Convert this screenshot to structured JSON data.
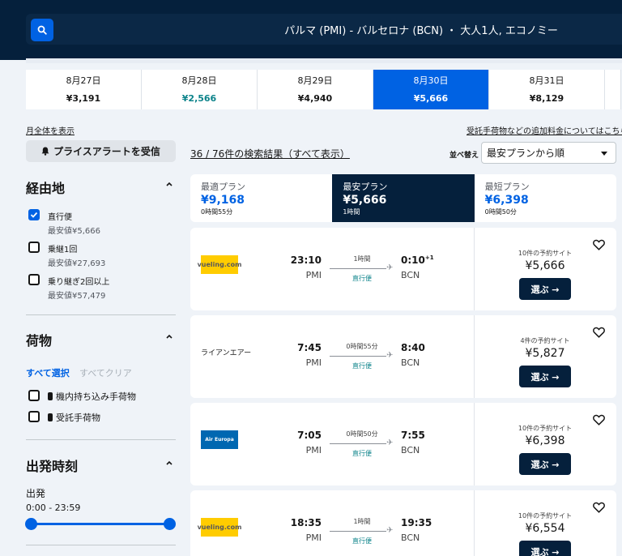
{
  "header": {
    "route": "パルマ (PMI) - バルセロナ (BCN)  ・ 大人1人, エコノミー",
    "search_icon": "search-icon"
  },
  "dates": [
    {
      "date": "8月27日",
      "price": "¥3,191",
      "state": "normal"
    },
    {
      "date": "8月28日",
      "price": "¥2,566",
      "state": "cheapest"
    },
    {
      "date": "8月29日",
      "price": "¥4,940",
      "state": "normal"
    },
    {
      "date": "8月30日",
      "price": "¥5,666",
      "state": "selected"
    },
    {
      "date": "8月31日",
      "price": "¥8,129",
      "state": "normal"
    }
  ],
  "links": {
    "whole_month": "月全体を表示",
    "baggage_fees": "受託手荷物などの追加料金についてはこちら"
  },
  "price_alert": "プライスアラートを受信",
  "filters": {
    "stops": {
      "title": "経由地",
      "options": [
        {
          "label": "直行便",
          "sub": "最安値¥5,666",
          "checked": true
        },
        {
          "label": "乗継1回",
          "sub": "最安値¥27,693",
          "checked": false
        },
        {
          "label": "乗り継ぎ2回以上",
          "sub": "最安値¥57,479",
          "checked": false
        }
      ]
    },
    "bags": {
      "title": "荷物",
      "select_all": "すべて選択",
      "clear_all": "すべてクリア",
      "options": [
        {
          "label": "機内持ち込み手荷物",
          "checked": false
        },
        {
          "label": "受託手荷物",
          "checked": false
        }
      ]
    },
    "departure_time": {
      "title": "出発時刻",
      "label": "出発",
      "range": "0:00 - 23:59",
      "min_fraction": 0,
      "max_fraction": 1
    }
  },
  "results": {
    "count": "36 / 76件の検索結果（すべて表示）",
    "sort_label": "並べ替え",
    "sort_value": "最安プランから順"
  },
  "summary_tabs": [
    {
      "title": "最適プラン",
      "price": "¥9,168",
      "duration": "0時間55分",
      "active": false
    },
    {
      "title": "最安プラン",
      "price": "¥5,666",
      "duration": "1時間",
      "active": true
    },
    {
      "title": "最短プラン",
      "price": "¥6,398",
      "duration": "0時間50分",
      "active": false
    }
  ],
  "flights": [
    {
      "airline": "vueling.com",
      "logo": "vueling",
      "dep_time": "23:10",
      "dep_code": "PMI",
      "arr_time": "0:10",
      "arr_plus": "+1",
      "arr_code": "BCN",
      "duration": "1時間",
      "stops": "直行便",
      "sites": "10件の予約サイト",
      "price": "¥5,666",
      "button": "選ぶ →"
    },
    {
      "airline": "ライアンエアー",
      "logo": "text",
      "dep_time": "7:45",
      "dep_code": "PMI",
      "arr_time": "8:40",
      "arr_plus": "",
      "arr_code": "BCN",
      "duration": "0時間55分",
      "stops": "直行便",
      "sites": "4件の予約サイト",
      "price": "¥5,827",
      "button": "選ぶ →"
    },
    {
      "airline": "Air Europa",
      "logo": "aireuropa",
      "dep_time": "7:05",
      "dep_code": "PMI",
      "arr_time": "7:55",
      "arr_plus": "",
      "arr_code": "BCN",
      "duration": "0時間50分",
      "stops": "直行便",
      "sites": "10件の予約サイト",
      "price": "¥6,398",
      "button": "選ぶ →"
    },
    {
      "airline": "vueling.com",
      "logo": "vueling",
      "dep_time": "18:35",
      "dep_code": "PMI",
      "arr_time": "19:35",
      "arr_plus": "",
      "arr_code": "BCN",
      "duration": "1時間",
      "stops": "直行便",
      "sites": "10件の予約サイト",
      "price": "¥6,554",
      "button": "選ぶ →"
    }
  ],
  "colors": {
    "header_bg": "#05203c",
    "accent": "#0062e3",
    "cheap_green": "#0c838a",
    "page_bg": "#eff3f8"
  }
}
